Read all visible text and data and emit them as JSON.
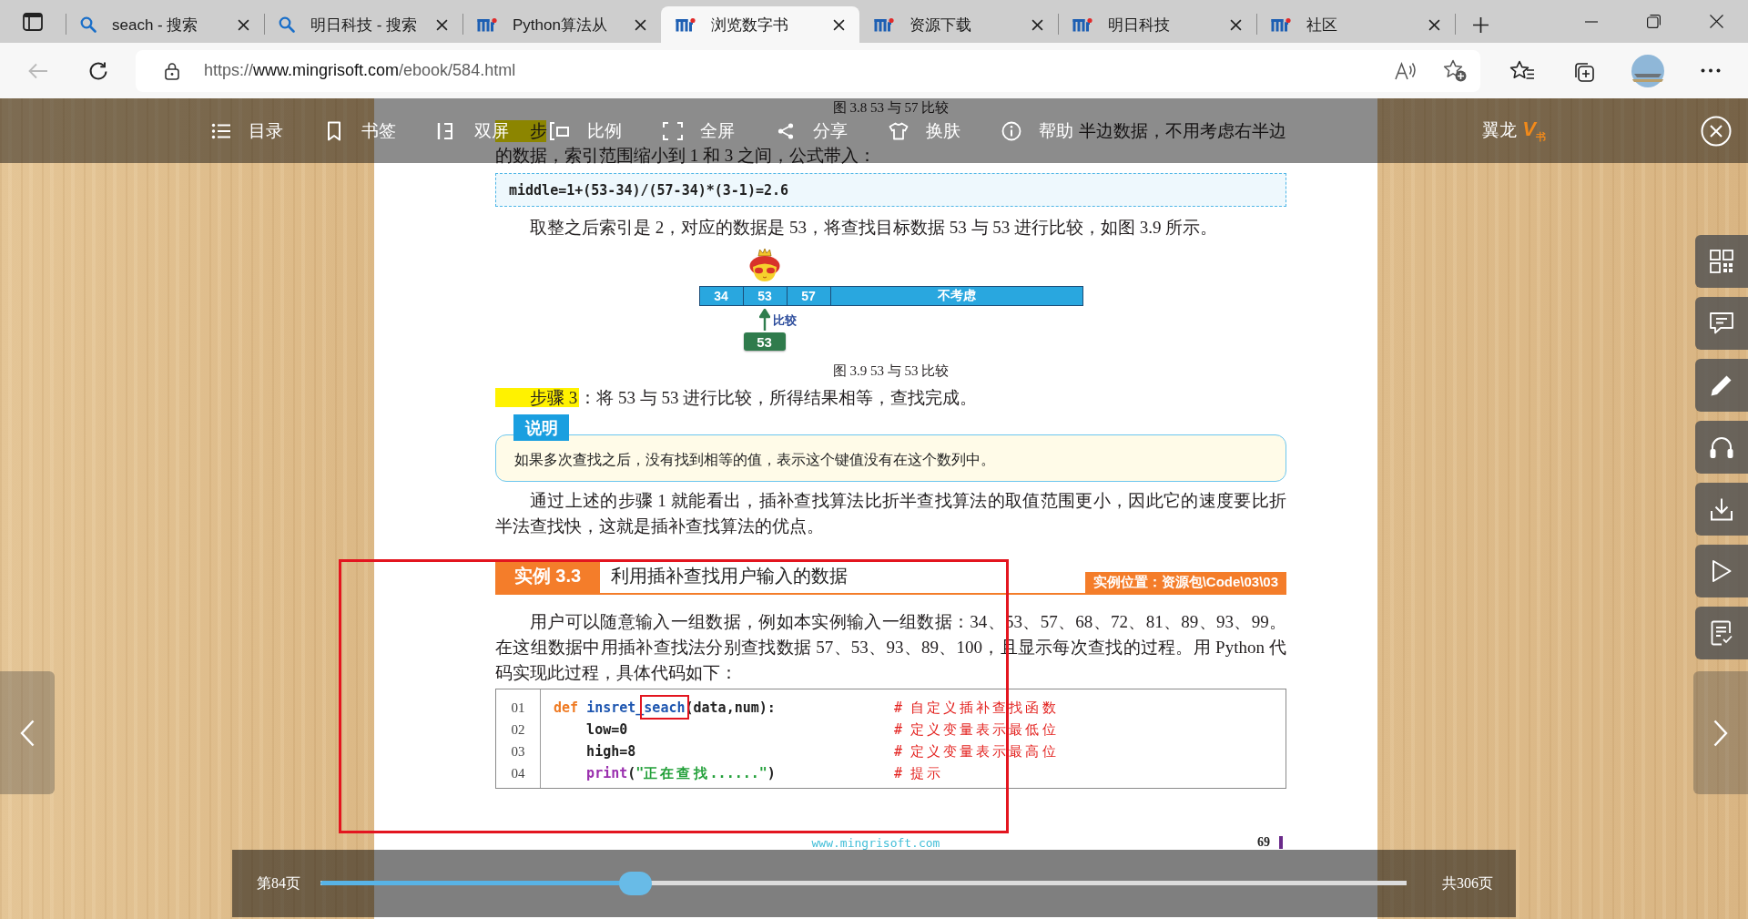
{
  "browser": {
    "tabs": [
      {
        "kind": "search",
        "title": "seach - 搜索",
        "selected": false
      },
      {
        "kind": "search",
        "title": "明日科技 - 搜索",
        "selected": false
      },
      {
        "kind": "site",
        "title": "Python算法从",
        "selected": false
      },
      {
        "kind": "site",
        "title": "浏览数字书",
        "selected": true
      },
      {
        "kind": "site",
        "title": "资源下载",
        "selected": false
      },
      {
        "kind": "site",
        "title": "明日科技",
        "selected": false
      },
      {
        "kind": "site",
        "title": "社区",
        "selected": false
      }
    ],
    "address": {
      "scheme": "https://",
      "host": "www.mingrisoft.com",
      "path": "/ebook/584.html"
    }
  },
  "reader": {
    "toolbar": [
      "目录",
      "书签",
      "双屏",
      "比例",
      "全屏",
      "分享",
      "换肤",
      "帮助"
    ],
    "user": {
      "name": "翼龙",
      "badge": "V$_{书}$"
    }
  },
  "page": {
    "blocks": [
      {
        "kind": "caption",
        "text": "图 3.8  53 与 57 比较"
      },
      {
        "kind": "covered_step",
        "label": "步",
        "highlighted": true,
        "tail": "半边数据，不用考虑右半边",
        "text": "的数据，索引范围缩小到 1 和 3 之间，公式带入："
      },
      {
        "kind": "formula",
        "text": "middle=1+(53-34)/(57-34)*(3-1)=2.6"
      },
      {
        "kind": "para",
        "text": "取整之后索引是 2，对应的数据是 53，将查找目标数据 53 与 53 进行比较，如图 3.9 所示。"
      },
      {
        "kind": "figure",
        "cells": [
          {
            "kind": "value",
            "text": "34",
            "compared": false
          },
          {
            "kind": "value",
            "text": "53",
            "compared": true
          },
          {
            "kind": "value",
            "text": "57",
            "compared": false
          },
          {
            "kind": "rest",
            "text": "不考虑",
            "compared": false
          }
        ],
        "pointer_label": "比较",
        "target": "53"
      },
      {
        "kind": "caption",
        "text": "图 3.9  53 与 53 比较"
      },
      {
        "kind": "step",
        "label": "步骤 3",
        "text": "：将 53 与 53 进行比较，所得结果相等，查找完成。"
      },
      {
        "kind": "note",
        "tag": "说明",
        "text": "如果多次查找之后，没有找到相等的值，表示这个键值没有在这个数列中。"
      },
      {
        "kind": "para",
        "text": "通过上述的步骤 1 就能看出，插补查找算法比折半查找算法的取值范围更小，因此它的速度要比折半法查找快，这就是插补查找算法的优点。"
      },
      {
        "kind": "example",
        "tag": "实例 3.3",
        "title": "利用插补查找用户输入的数据",
        "location": "实例位置：资源包\\Code\\03\\03"
      },
      {
        "kind": "para",
        "text": "用户可以随意输入一组数据，例如本实例输入一组数据：34、53、57、68、72、81、89、93、99。在这组数据中用插补查找法分别查找数据 57、53、93、89、100，且显示每次查找的过程。用 Python 代码实现此过程，具体代码如下："
      },
      {
        "kind": "code",
        "lines": [
          {
            "number": "01",
            "indent": false,
            "code": [
              {
                "kind": "keyword",
                "text": "def ",
                "marked": false
              },
              {
                "kind": "name",
                "text": "insret_",
                "marked": false
              },
              {
                "kind": "name",
                "text": "seach",
                "marked": true
              },
              {
                "kind": "plain",
                "text": "(data,num):",
                "marked": false
              }
            ],
            "comment": "# 自定义插补查找函数"
          },
          {
            "number": "02",
            "indent": true,
            "code": [
              {
                "kind": "plain",
                "text": "low=0",
                "marked": false
              }
            ],
            "comment": "# 定义变量表示最低位"
          },
          {
            "number": "03",
            "indent": true,
            "code": [
              {
                "kind": "plain",
                "text": "high=8",
                "marked": false
              }
            ],
            "comment": "# 定义变量表示最高位"
          },
          {
            "number": "04",
            "indent": true,
            "code": [
              {
                "kind": "builtin",
                "text": "print",
                "marked": false
              },
              {
                "kind": "plain",
                "text": "(",
                "marked": false
              },
              {
                "kind": "string",
                "text": "\"正在查找......\"",
                "marked": false
              },
              {
                "kind": "plain",
                "text": ")",
                "marked": false
              }
            ],
            "comment": "# 提示"
          }
        ]
      }
    ],
    "footer": {
      "site": "www.mingrisoft.com",
      "number": "69"
    }
  },
  "pager": {
    "current": "第84页",
    "total": "共306页",
    "level": 0.29
  }
}
